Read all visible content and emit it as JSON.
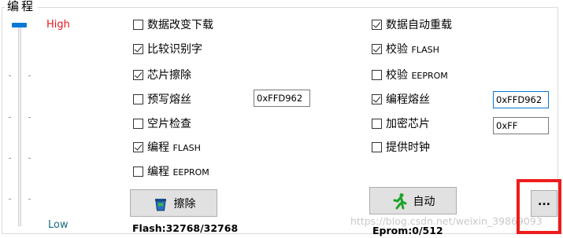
{
  "group": {
    "title": "编程"
  },
  "slider": {
    "high_label": "High",
    "low_label": "Low",
    "level": 1.0
  },
  "options_left": [
    {
      "label": "数据改变下载",
      "checked": false
    },
    {
      "label": "比较识别字",
      "checked": true
    },
    {
      "label": "芯片擦除",
      "checked": true
    },
    {
      "label": "预写熔丝",
      "checked": false
    },
    {
      "label": "空片检查",
      "checked": false
    },
    {
      "label": "编程",
      "suffix": "FLASH",
      "checked": true
    },
    {
      "label": "编程",
      "suffix": "EEPROM",
      "checked": false
    }
  ],
  "options_right": [
    {
      "label": "数据自动重载",
      "checked": true
    },
    {
      "label": "校验",
      "suffix": "FLASH",
      "checked": true
    },
    {
      "label": "校验",
      "suffix": "EEPROM",
      "checked": false
    },
    {
      "label": "编程熔丝",
      "checked": true
    },
    {
      "label": "加密芯片",
      "checked": false
    },
    {
      "label": "提供时钟",
      "checked": false
    }
  ],
  "inputs": {
    "prewrite_fuse_value": "0xFFD962",
    "program_fuse_value": "0xFFD962",
    "encrypt_value": "0xFF"
  },
  "buttons": {
    "erase_label": "擦除",
    "auto_label": "自动",
    "more_label": "..."
  },
  "status": {
    "flash": "Flash:32768/32768",
    "eprom": "Eprom:0/512"
  },
  "watermark": "https://blog.csdn.net/weixin_39869093",
  "colors": {
    "high": "#e8141c",
    "low": "#1a6b82",
    "accent": "#0a78d7",
    "highlight": "#ee1c1c"
  }
}
